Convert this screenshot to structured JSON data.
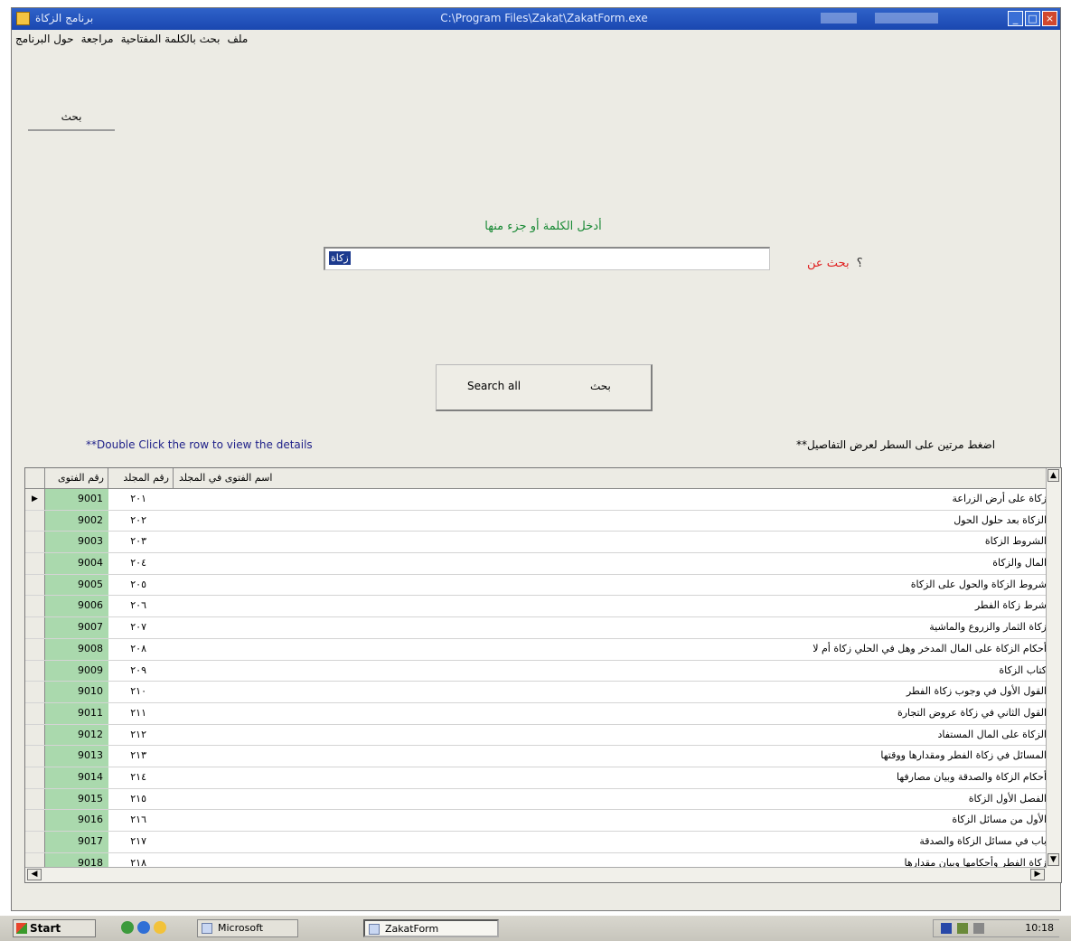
{
  "window": {
    "title": "برنامج الزكاة",
    "path": "C:\\Program Files\\Zakat\\ZakatForm.exe",
    "controls": [
      "_",
      "□",
      "×"
    ]
  },
  "menu": [
    "ملف",
    "بحث بالكلمة المفتاحية",
    "مراجعة",
    "حول البرنامج"
  ],
  "tab": {
    "label": "بحث"
  },
  "prompt": "أدخل الكلمة أو جزء منها",
  "field_label": "بحث عن",
  "field_question": "؟",
  "search_input": {
    "value": "زكاة"
  },
  "buttons": {
    "search_all": "Search all",
    "search": "بحث"
  },
  "hint_left": "**Double Click the row to view the details",
  "hint_right": "**اضغط مرتين على السطر لعرض التفاصيل",
  "table": {
    "columns": [
      "رقم الفتوى",
      "رقم المجلد",
      "اسم الفتوى في المجلد"
    ],
    "rows": [
      [
        "9001",
        "٢٠١",
        "زكاة على أرض الزراعة"
      ],
      [
        "9002",
        "٢٠٢",
        "الزكاة بعد حلول الحول"
      ],
      [
        "9003",
        "٢٠٣",
        "الشروط الزكاة"
      ],
      [
        "9004",
        "٢٠٤",
        "المال والزكاة"
      ],
      [
        "9005",
        "٢٠٥",
        "شروط الزكاة والحول على الزكاة"
      ],
      [
        "9006",
        "٢٠٦",
        "شرط زكاة الفطر"
      ],
      [
        "9007",
        "٢٠٧",
        "زكاة الثمار والزروع والماشية"
      ],
      [
        "9008",
        "٢٠٨",
        "أحكام الزكاة على المال المدخر وهل في الحلي زكاة أم لا"
      ],
      [
        "9009",
        "٢٠٩",
        "كتاب الزكاة"
      ],
      [
        "9010",
        "٢١٠",
        "القول الأول في وجوب زكاة الفطر"
      ],
      [
        "9011",
        "٢١١",
        "القول الثاني في زكاة عروض التجارة"
      ],
      [
        "9012",
        "٢١٢",
        "الزكاة على المال المستفاد"
      ],
      [
        "9013",
        "٢١٣",
        "المسائل في زكاة الفطر ومقدارها ووقتها"
      ],
      [
        "9014",
        "٢١٤",
        "أحكام الزكاة والصدقة وبيان مصارفها"
      ],
      [
        "9015",
        "٢١٥",
        "الفصل الأول الزكاة"
      ],
      [
        "9016",
        "٢١٦",
        "الأول من مسائل الزكاة"
      ],
      [
        "9017",
        "٢١٧",
        "باب في مسائل الزكاة والصدقة"
      ],
      [
        "9018",
        "٢١٨",
        "زكاة الفطر وأحكامها وبيان مقدارها"
      ]
    ]
  },
  "taskbar": {
    "start": "Start",
    "tasks": [
      "Microsoft",
      "ZakatForm"
    ],
    "clock": "10:18"
  }
}
